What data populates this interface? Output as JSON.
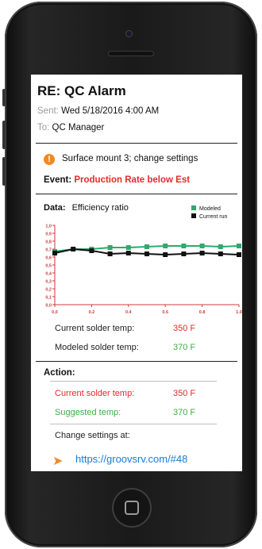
{
  "email": {
    "subject": "RE: QC Alarm",
    "sent_label": "Sent:",
    "sent_value": "Wed 5/18/2016 4:00 AM",
    "to_label": "To:",
    "to_value": "QC Manager"
  },
  "alert": {
    "icon": "exclamation-icon",
    "text": "Surface mount 3; change settings"
  },
  "event": {
    "label": "Event:",
    "value": "Production Rate below Est"
  },
  "data": {
    "label": "Data:",
    "metric": "Efficiency ratio"
  },
  "chart_data": {
    "type": "line",
    "title": "",
    "xlabel": "",
    "ylabel": "",
    "x": [
      0.0,
      0.1,
      0.2,
      0.3,
      0.4,
      0.5,
      0.6,
      0.7,
      0.8,
      0.9,
      1.0
    ],
    "xlim": [
      0.0,
      1.0
    ],
    "ylim": [
      0.0,
      1.0
    ],
    "x_ticks": [
      "0,0",
      "0.2",
      "0.4",
      "0.6",
      "0.8",
      "1.0"
    ],
    "x_tick_values": [
      0.0,
      0.2,
      0.4,
      0.6,
      0.8,
      1.0
    ],
    "y_ticks": [
      "1,0",
      "0,9",
      "0,8",
      "0,7",
      "0,6",
      "0,5",
      "0,4",
      "0,3",
      "0,2",
      "0,1",
      "0,0"
    ],
    "y_tick_values": [
      1.0,
      0.9,
      0.8,
      0.7,
      0.6,
      0.5,
      0.4,
      0.3,
      0.2,
      0.1,
      0.0
    ],
    "grid": false,
    "legend_position": "top-right",
    "series": [
      {
        "name": "Modeled",
        "color": "#2eaa6a",
        "values": [
          0.67,
          0.7,
          0.7,
          0.72,
          0.72,
          0.73,
          0.74,
          0.74,
          0.74,
          0.73,
          0.74
        ]
      },
      {
        "name": "Current run",
        "color": "#111111",
        "values": [
          0.65,
          0.7,
          0.68,
          0.64,
          0.65,
          0.64,
          0.63,
          0.64,
          0.65,
          0.64,
          0.63
        ]
      }
    ]
  },
  "temps": {
    "current_label": "Current solder temp:",
    "current_value": "350 F",
    "modeled_label": "Modeled solder temp:",
    "modeled_value": "370 F"
  },
  "action": {
    "label": "Action:",
    "current_label": "Current solder temp:",
    "current_value": "350 F",
    "suggested_label": "Suggested temp:",
    "suggested_value": "370 F",
    "change_label": "Change settings at:",
    "link_text": "https://groovsrv.com/#48",
    "link_icon": "arrow-right-icon"
  },
  "colors": {
    "alert_orange": "#f08a24",
    "alarm_red": "#e8282a",
    "ok_green": "#3cb043",
    "link_blue": "#1a7ad6",
    "axis_red": "#d23a3a"
  }
}
